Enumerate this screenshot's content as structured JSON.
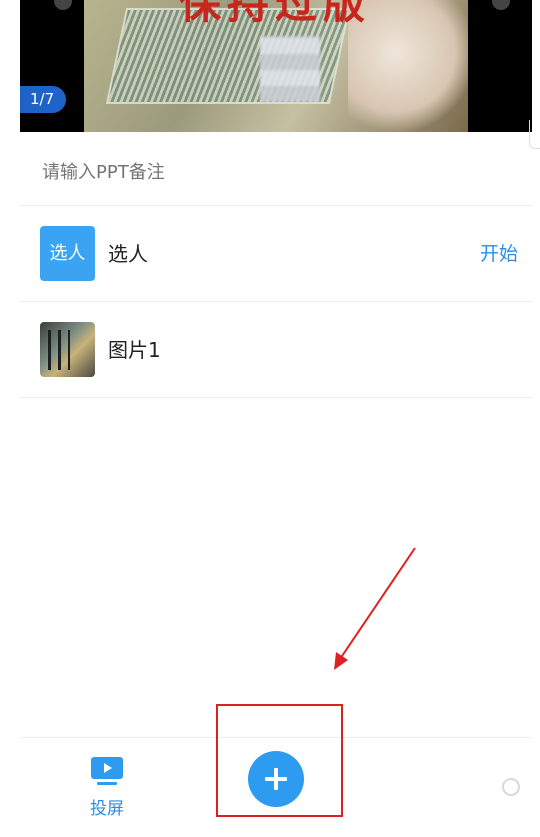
{
  "slide": {
    "title": "保持过版",
    "page_indicator": "1/7"
  },
  "note": {
    "placeholder": "请输入PPT备注"
  },
  "list": [
    {
      "icon_text": "选人",
      "label": "选人",
      "action": "开始"
    },
    {
      "label": "图片1"
    }
  ],
  "bottom_bar": {
    "cast_label": "投屏"
  },
  "colors": {
    "accent": "#2d9bf0",
    "badge": "#1e63c7",
    "annotation": "#e02020"
  },
  "icons": [
    "cast-screen-icon",
    "plus-icon",
    "person-select-icon"
  ]
}
